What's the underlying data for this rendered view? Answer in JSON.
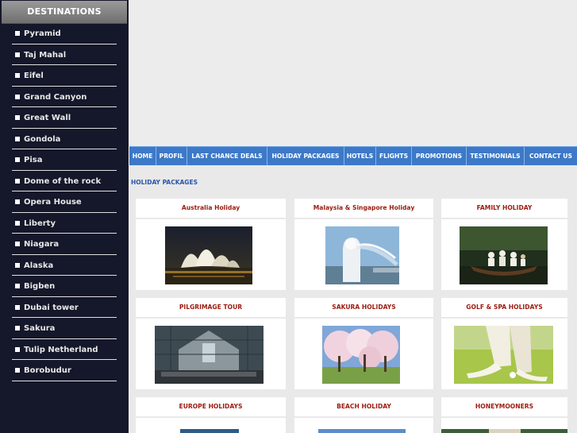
{
  "sidebar": {
    "title": "DESTINATIONS",
    "items": [
      {
        "label": "Pyramid"
      },
      {
        "label": "Taj Mahal"
      },
      {
        "label": "Eifel"
      },
      {
        "label": "Grand Canyon"
      },
      {
        "label": "Great Wall"
      },
      {
        "label": "Gondola"
      },
      {
        "label": "Pisa"
      },
      {
        "label": "Dome of the rock"
      },
      {
        "label": "Opera House"
      },
      {
        "label": "Liberty"
      },
      {
        "label": "Niagara"
      },
      {
        "label": "Alaska"
      },
      {
        "label": "Bigben"
      },
      {
        "label": "Dubai tower"
      },
      {
        "label": "Sakura"
      },
      {
        "label": "Tulip Netherland"
      },
      {
        "label": "Borobudur"
      }
    ]
  },
  "nav": {
    "items": [
      {
        "label": "HOME"
      },
      {
        "label": "PROFIL"
      },
      {
        "label": "LAST CHANCE DEALS"
      },
      {
        "label": "HOLIDAY PACKAGES"
      },
      {
        "label": "HOTELS"
      },
      {
        "label": "FLIGHTS"
      },
      {
        "label": "PROMOTIONS"
      },
      {
        "label": "TESTIMONIALS"
      },
      {
        "label": "CONTACT US"
      }
    ]
  },
  "main": {
    "breadcrumb": "HOLIDAY PACKAGES",
    "packages": [
      {
        "title": "Australia Holiday",
        "image": "sydney-opera-house-night"
      },
      {
        "title": "Malaysia & Singapore Holiday",
        "image": "merlion-fountain"
      },
      {
        "title": "FAMILY HOLIDAY",
        "image": "family-boat-ride"
      },
      {
        "title": "PILGRIMAGE TOUR",
        "image": "church-pilgrims"
      },
      {
        "title": "SAKURA HOLIDAYS",
        "image": "cherry-blossom-park"
      },
      {
        "title": "GOLF & SPA HOLIDAYS",
        "image": "golf-ball-tee"
      },
      {
        "title": "EUROPE HOLIDAYS",
        "image": "europe-scene"
      },
      {
        "title": "BEACH HOLIDAY",
        "image": "beach-scene"
      },
      {
        "title": "HONEYMOONERS",
        "image": "honeymoon-couple"
      }
    ]
  },
  "colors": {
    "sidebar_bg": "#15172a",
    "nav_bg": "#3c79c8",
    "package_title": "#9c1b0e",
    "breadcrumb": "#2a56a8"
  }
}
